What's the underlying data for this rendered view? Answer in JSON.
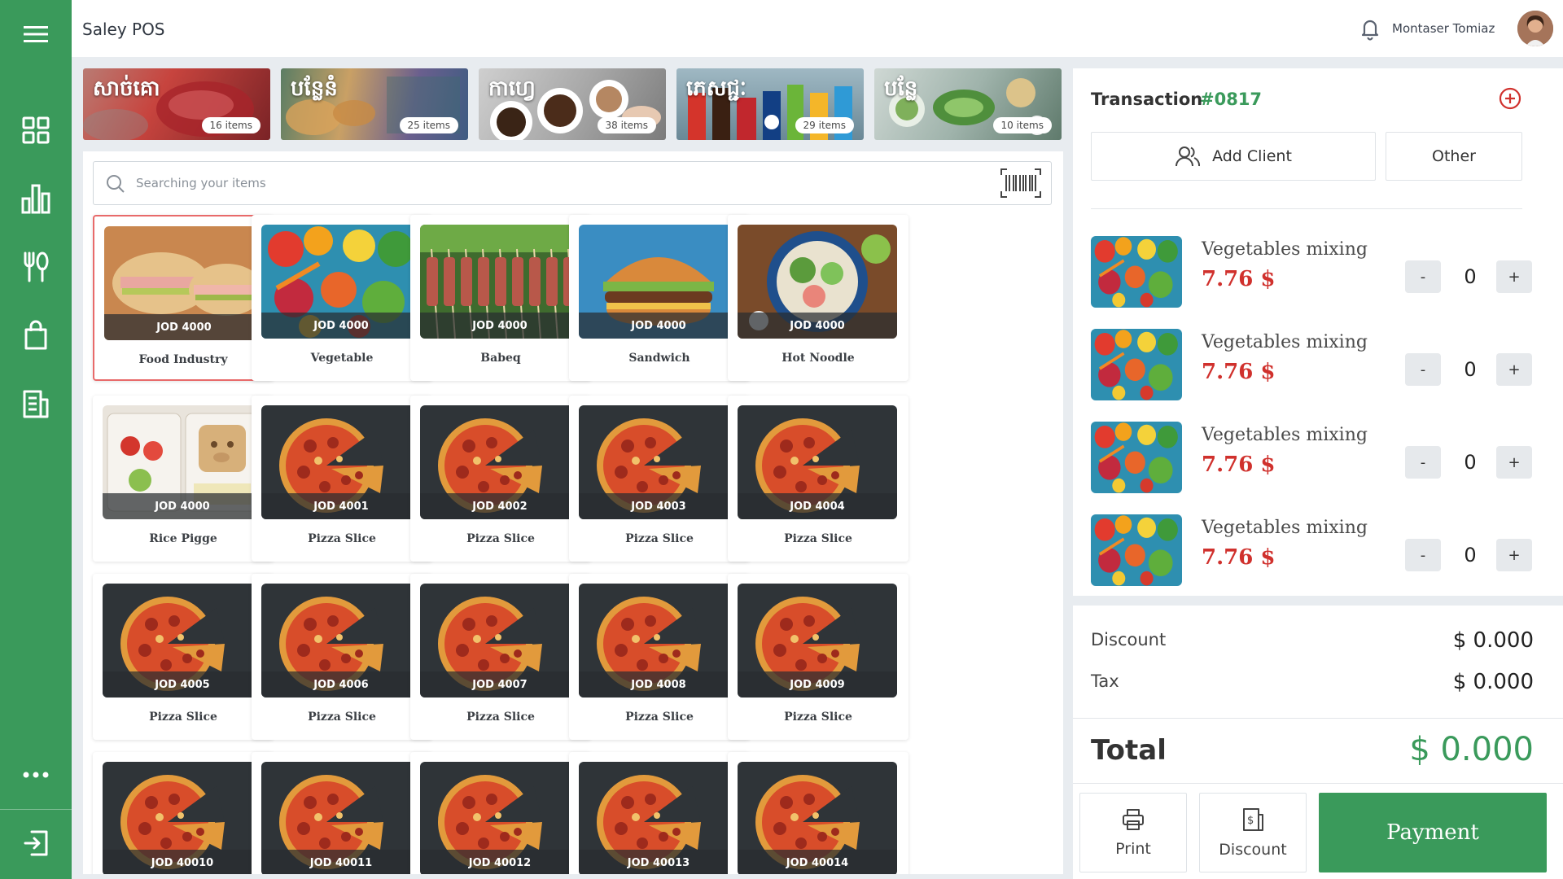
{
  "app": {
    "title": "Saley POS"
  },
  "user": {
    "name": "Montaser Tomiaz"
  },
  "sidebar": {
    "items": [
      {
        "icon": "menu-icon"
      },
      {
        "icon": "dashboard-icon"
      },
      {
        "icon": "chart-icon"
      },
      {
        "icon": "utensils-icon"
      },
      {
        "icon": "shopping-bag-icon"
      },
      {
        "icon": "report-icon"
      },
      {
        "icon": "more-icon"
      },
      {
        "icon": "logout-icon"
      }
    ]
  },
  "categories": [
    {
      "title": "សាច់គោ",
      "count": "16 items"
    },
    {
      "title": "បន្លែនំ",
      "count": "25 items"
    },
    {
      "title": "កាហ្វេ",
      "count": "38 items"
    },
    {
      "title": "ភេសជ្ជៈ",
      "count": "29 items"
    },
    {
      "title": "បន្លែ",
      "count": "10 items"
    }
  ],
  "search": {
    "placeholder": "Searching your items"
  },
  "products": [
    {
      "price": "JOD 4000",
      "name": "Food Industry",
      "image": "sandwich",
      "selected": true
    },
    {
      "price": "JOD 4000",
      "name": "Vegetable",
      "image": "vegetables"
    },
    {
      "price": "JOD 4000",
      "name": "Babeq",
      "image": "skewers"
    },
    {
      "price": "JOD 4000",
      "name": "Sandwich",
      "image": "burger"
    },
    {
      "price": "JOD 4000",
      "name": "Hot Noodle",
      "image": "bowl"
    },
    {
      "price": "JOD 4000",
      "name": "Rice Pigge",
      "image": "bento"
    },
    {
      "price": "JOD 4001",
      "name": "Pizza Slice",
      "image": "pizza"
    },
    {
      "price": "JOD 4002",
      "name": "Pizza Slice",
      "image": "pizza"
    },
    {
      "price": "JOD 4003",
      "name": "Pizza Slice",
      "image": "pizza"
    },
    {
      "price": "JOD 4004",
      "name": "Pizza Slice",
      "image": "pizza"
    },
    {
      "price": "JOD 4005",
      "name": "Pizza Slice",
      "image": "pizza"
    },
    {
      "price": "JOD 4006",
      "name": "Pizza Slice",
      "image": "pizza"
    },
    {
      "price": "JOD 4007",
      "name": "Pizza Slice",
      "image": "pizza"
    },
    {
      "price": "JOD 4008",
      "name": "Pizza Slice",
      "image": "pizza"
    },
    {
      "price": "JOD 4009",
      "name": "Pizza Slice",
      "image": "pizza"
    },
    {
      "price": "JOD 40010",
      "name": "Pizza Slice",
      "image": "pizza"
    },
    {
      "price": "JOD 40011",
      "name": "Pizza Slice",
      "image": "pizza"
    },
    {
      "price": "JOD 40012",
      "name": "Pizza Slice",
      "image": "pizza"
    },
    {
      "price": "JOD 40013",
      "name": "Pizza Slice",
      "image": "pizza"
    },
    {
      "price": "JOD 40014",
      "name": "Pizza Slice",
      "image": "pizza"
    }
  ],
  "transaction": {
    "label": "Transaction",
    "number": "#0817",
    "add_client": "Add Client",
    "other": "Other",
    "lines": [
      {
        "name": "Vegetables mixing",
        "price": "7.76 $",
        "qty": "0",
        "minus": "-",
        "plus": "+"
      },
      {
        "name": "Vegetables mixing",
        "price": "7.76 $",
        "qty": "0",
        "minus": "-",
        "plus": "+"
      },
      {
        "name": "Vegetables mixing",
        "price": "7.76 $",
        "qty": "0",
        "minus": "-",
        "plus": "+"
      },
      {
        "name": "Vegetables mixing",
        "price": "7.76 $",
        "qty": "0",
        "minus": "-",
        "plus": "+"
      }
    ]
  },
  "summary": {
    "discount_label": "Discount",
    "discount_value": "$ 0.000",
    "tax_label": "Tax",
    "tax_value": "$ 0.000",
    "total_label": "Total",
    "total_value": "$ 0.000"
  },
  "actions": {
    "print": "Print",
    "discount": "Discount",
    "payment": "Payment"
  },
  "colors": {
    "brand": "#3a9a5b",
    "price_red": "#d0312d",
    "selected_border": "#e86a6a"
  }
}
